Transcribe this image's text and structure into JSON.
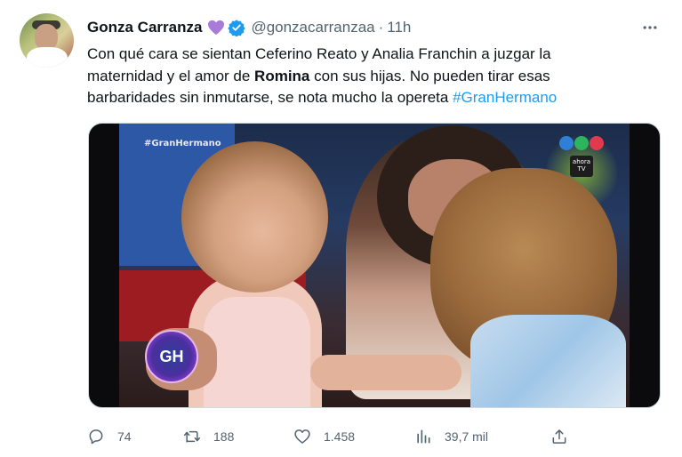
{
  "tweet": {
    "author_name": "Gonza Carranza",
    "handle": "@gonzacarranzaa",
    "separator": "·",
    "time": "11h",
    "text_lines": [
      {
        "before": "Con qué cara se sientan Ceferino Reato y Analia Franchin a juzgar la"
      },
      {
        "before": "maternidad y el amor de ",
        "bold": "Romina",
        "after": " con sus hijas. No pueden tirar esas"
      },
      {
        "before": "barbaridades sin inmutarse, se nota mucho la opereta ",
        "hashtag": "#GranHermano"
      }
    ],
    "media": {
      "watermark": "#GranHermano",
      "channel_badge": "ahora TV",
      "logo_text": "GH"
    },
    "stats": {
      "replies": "74",
      "retweets": "188",
      "likes": "1.458",
      "views": "39,7 mil"
    },
    "colors": {
      "accent": "#1d9bf0",
      "secondary_text": "#536471",
      "heart_emoji": "#a97bd9",
      "verified": "#1d9bf0"
    },
    "icons": {
      "heart": "purple-heart-icon",
      "verified": "verified-badge-icon",
      "more": "more-horizontal-icon",
      "reply": "reply-icon",
      "retweet": "retweet-icon",
      "like": "like-icon",
      "views": "views-icon",
      "share": "share-icon"
    }
  }
}
